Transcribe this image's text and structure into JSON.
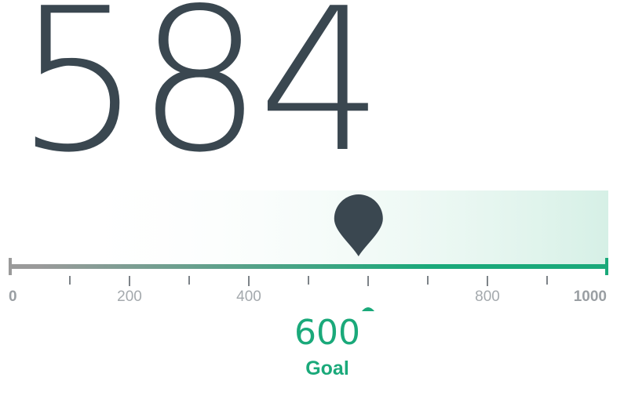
{
  "score": {
    "value": "584",
    "numeric": 584
  },
  "scale": {
    "min": 0,
    "max": 1000,
    "labels": [
      {
        "value": 0,
        "text": "0",
        "emphasis": true
      },
      {
        "value": 200,
        "text": "200",
        "emphasis": false
      },
      {
        "value": 400,
        "text": "400",
        "emphasis": false
      },
      {
        "value": 800,
        "text": "800",
        "emphasis": false
      },
      {
        "value": 1000,
        "text": "1000",
        "emphasis": true
      }
    ],
    "minor_ticks": [
      100,
      300,
      500,
      700,
      900
    ],
    "major_ticks": [
      200,
      400,
      600,
      800
    ]
  },
  "goal": {
    "value": "600",
    "numeric": 600,
    "label": "Goal"
  },
  "colors": {
    "text_dark": "#3a4750",
    "accent_green": "#1aa97a",
    "track_gray": "#9a9a9a",
    "tick_gray": "#a4a9ad"
  },
  "icons": {
    "marker": "map-pin-icon",
    "goal_pointer": "triangle-up-icon"
  }
}
